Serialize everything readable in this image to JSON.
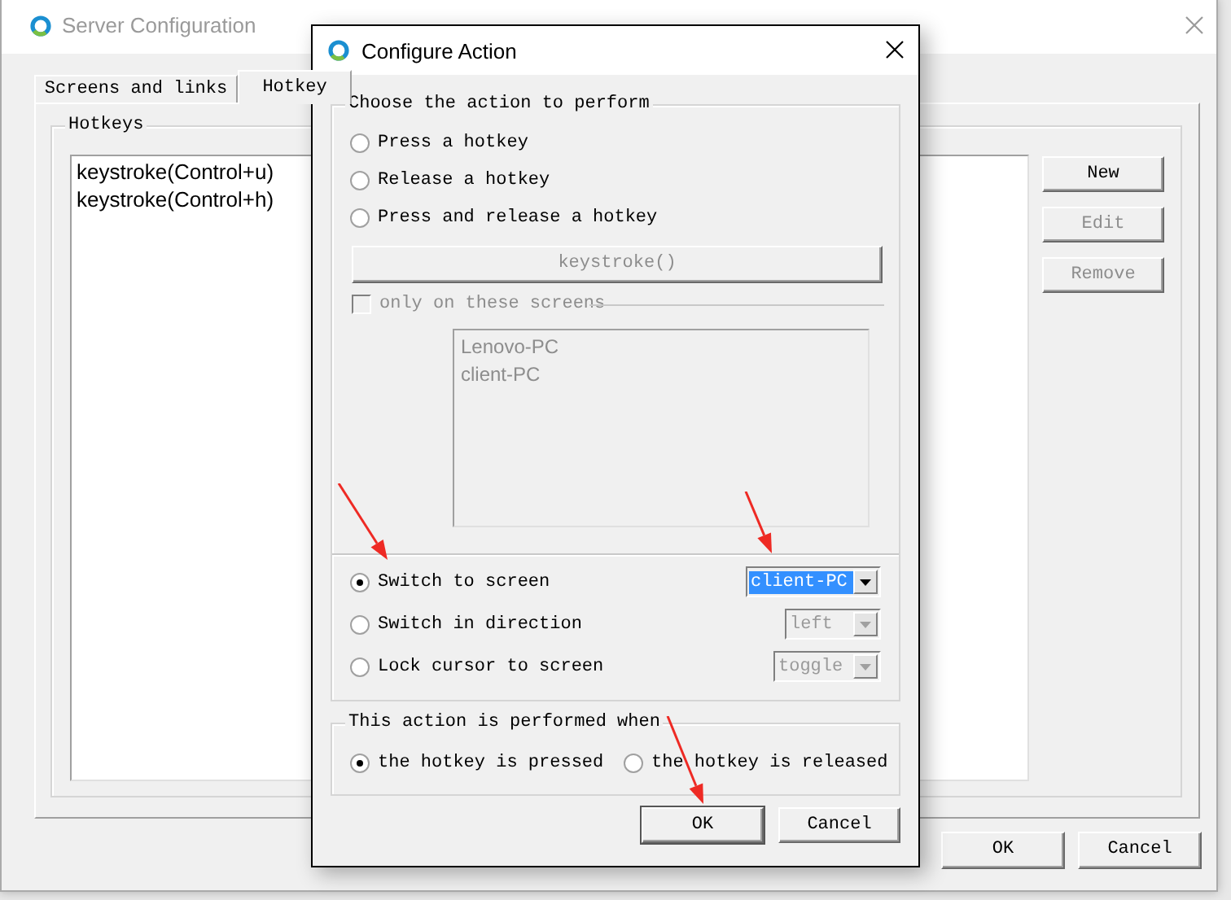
{
  "main_window": {
    "title": "Server Configuration",
    "tabs": [
      {
        "label": "Screens and links",
        "selected": false
      },
      {
        "label": "Hotkey",
        "selected": true
      }
    ],
    "hotkeys_group": {
      "title": "Hotkeys",
      "items": [
        "keystroke(Control+u)",
        "keystroke(Control+h)"
      ]
    },
    "side_buttons": [
      {
        "label": "New",
        "disabled": false
      },
      {
        "label": "Edit",
        "disabled": true
      },
      {
        "label": "Remove",
        "disabled": true
      }
    ],
    "footer_buttons": [
      "OK",
      "Cancel"
    ]
  },
  "dialog": {
    "title": "Configure Action",
    "action_group": {
      "title": "Choose the action to perform",
      "hotkey_options": [
        {
          "label": "Press a hotkey",
          "selected": false
        },
        {
          "label": "Release a hotkey",
          "selected": false
        },
        {
          "label": "Press and release a hotkey",
          "selected": false
        }
      ],
      "keystroke_button": {
        "label": "keystroke()",
        "disabled": true
      },
      "only_on_screens": {
        "label": "only on these screens",
        "checked": false,
        "disabled": true
      },
      "screens": {
        "items": [
          "Lenovo-PC",
          "client-PC"
        ],
        "disabled": true
      },
      "screen_options": [
        {
          "label": "Switch to screen",
          "selected": true,
          "dropdown": {
            "value": "client-PC",
            "disabled": false,
            "highlighted": true
          }
        },
        {
          "label": "Switch in direction",
          "selected": false,
          "dropdown": {
            "value": "left",
            "disabled": true,
            "highlighted": false
          }
        },
        {
          "label": "Lock cursor to screen",
          "selected": false,
          "dropdown": {
            "value": "toggle",
            "disabled": true,
            "highlighted": false
          }
        }
      ]
    },
    "when_group": {
      "title": "This action is performed when",
      "options": [
        {
          "label": "the hotkey is pressed",
          "selected": true
        },
        {
          "label": "the hotkey is released",
          "selected": false
        }
      ]
    },
    "buttons": [
      {
        "label": "OK",
        "default": true
      },
      {
        "label": "Cancel",
        "default": false
      }
    ]
  },
  "annotations": [
    {
      "kind": "arrow"
    },
    {
      "kind": "arrow"
    },
    {
      "kind": "arrow"
    }
  ]
}
